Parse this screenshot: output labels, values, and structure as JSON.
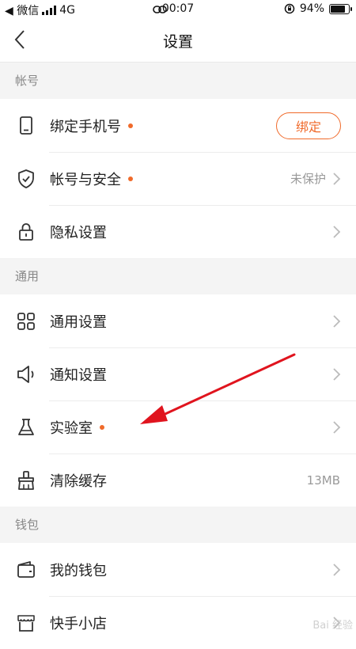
{
  "status": {
    "back_app": "◀ 微信",
    "network": "4G",
    "time": "00:07",
    "battery": "94%",
    "battery_level": 0.94
  },
  "nav": {
    "title": "设置"
  },
  "sections": [
    {
      "header": "帐号"
    },
    {
      "header": "通用"
    },
    {
      "header": "钱包"
    }
  ],
  "account": {
    "phone": {
      "label": "绑定手机号",
      "button": "绑定",
      "icon": "phone-icon"
    },
    "security": {
      "label": "帐号与安全",
      "value": "未保护",
      "icon": "shield-check-icon"
    },
    "privacy": {
      "label": "隐私设置",
      "icon": "lock-icon"
    }
  },
  "general": {
    "settings": {
      "label": "通用设置",
      "icon": "grid-icon"
    },
    "notify": {
      "label": "通知设置",
      "icon": "speaker-icon"
    },
    "lab": {
      "label": "实验室",
      "icon": "flask-icon"
    },
    "cache": {
      "label": "清除缓存",
      "value": "13MB",
      "icon": "broom-icon"
    }
  },
  "wallet": {
    "mine": {
      "label": "我的钱包",
      "icon": "wallet-icon"
    },
    "shop": {
      "label": "快手小店",
      "icon": "shop-icon"
    }
  },
  "colors": {
    "accent": "#f06a2a",
    "annotation_arrow": "#e0141e"
  },
  "watermark": "Bai 经验"
}
